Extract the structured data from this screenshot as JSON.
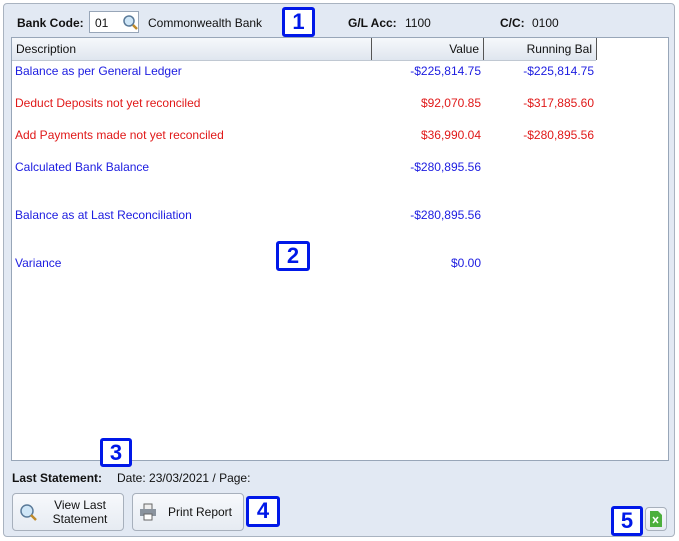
{
  "header": {
    "bank_code_label": "Bank Code:",
    "bank_code_value": "01",
    "bank_name": "Commonwealth Bank",
    "gl_label": "G/L Acc:",
    "gl_value": "1100",
    "cc_label": "C/C:",
    "cc_value": "0100"
  },
  "grid": {
    "columns": [
      "Description",
      "Value",
      "Running Bal"
    ],
    "rows": [
      {
        "description": "Balance as per General Ledger",
        "value": "-$225,814.75",
        "running": "-$225,814.75",
        "color": "blue"
      },
      {
        "description": "Deduct Deposits not yet reconciled",
        "value": "$92,070.85",
        "running": "-$317,885.60",
        "color": "red"
      },
      {
        "description": "Add Payments made not yet reconciled",
        "value": "$36,990.04",
        "running": "-$280,895.56",
        "color": "red"
      },
      {
        "description": "Calculated Bank Balance",
        "value": "-$280,895.56",
        "running": "",
        "color": "blue"
      },
      {
        "description": "Balance as at Last Reconciliation",
        "value": "-$280,895.56",
        "running": "",
        "color": "blue"
      },
      {
        "description": "Variance",
        "value": "$0.00",
        "running": "",
        "color": "blue"
      }
    ]
  },
  "footer": {
    "last_statement_label": "Last Statement:",
    "last_statement_value": "Date: 23/03/2021 / Page:",
    "view_button": "View Last Statement",
    "print_button": "Print Report"
  },
  "badges": [
    "1",
    "2",
    "3",
    "4",
    "5"
  ],
  "colors": {
    "blue": "#1c1ce0",
    "red": "#e01818",
    "badge": "#0018e8"
  }
}
